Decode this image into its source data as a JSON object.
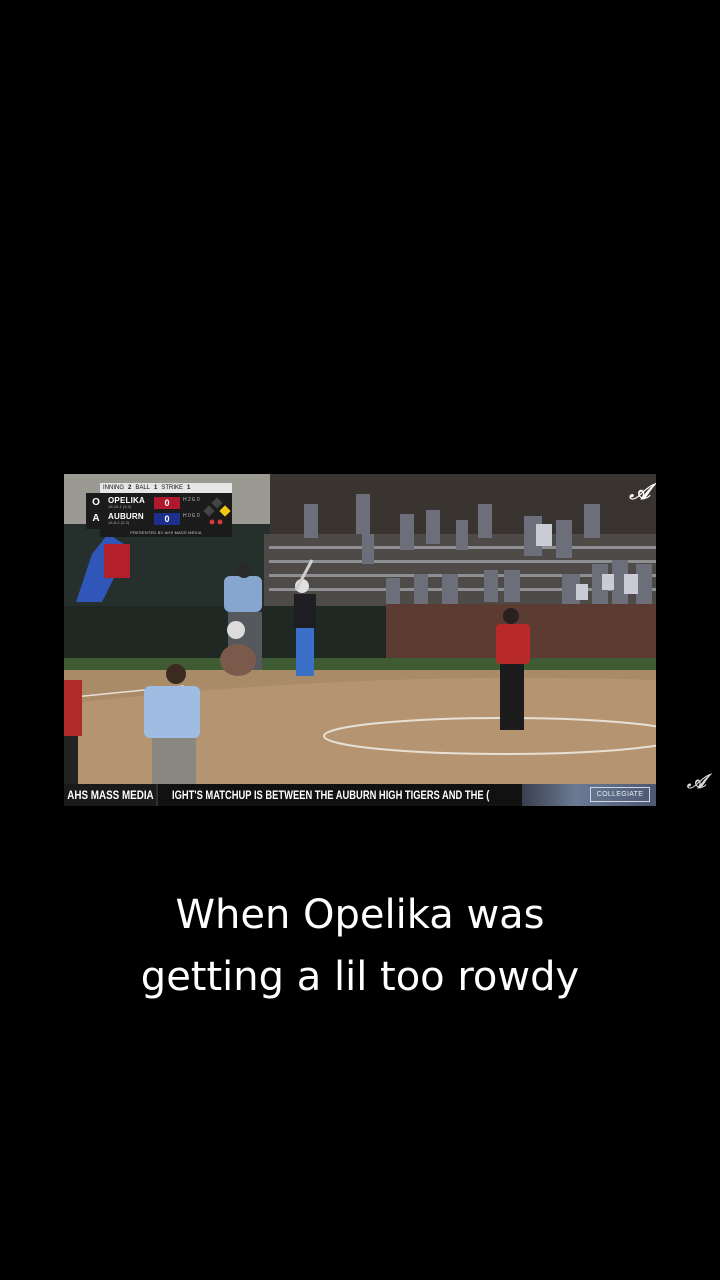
{
  "scorebug": {
    "inning_label": "INNING",
    "inning": "2",
    "ball_label": "BALL",
    "ball": "1",
    "strike_label": "STRIKE",
    "strike": "1",
    "home": {
      "logo": "O",
      "name": "OPELIKA",
      "record": "15-10-1 (3-2)",
      "score": "0",
      "hits": "H 2  E 0",
      "color": "#b0192b"
    },
    "away": {
      "logo": "A",
      "name": "AUBURN",
      "record": "15-8-2 (3-2)",
      "score": "0",
      "hits": "H 0  E 0",
      "color": "#1c2f8c"
    },
    "presented_by": "PRESENTED BY AHS MASS MEDIA"
  },
  "ticker": {
    "brand": "AHS MASS MEDIA",
    "message": "IGHT'S MATCHUP IS BETWEEN THE AUBURN HIGH TIGERS AND THE (",
    "sponsor": "COLLEGIATE"
  },
  "caption": {
    "line1": "When Opelika was",
    "line2": "getting a lil too rowdy"
  },
  "watermark": {
    "icon": "tiger-logo-icon"
  }
}
